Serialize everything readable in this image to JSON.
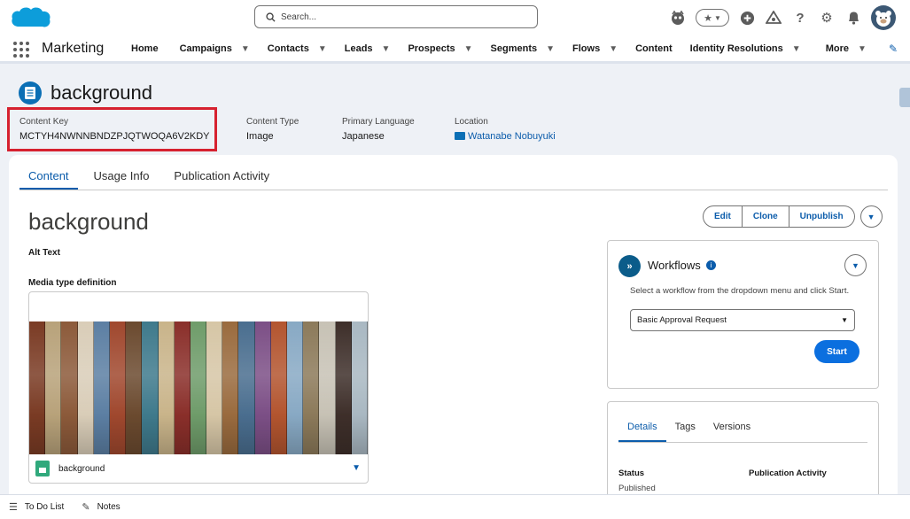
{
  "header": {
    "search_placeholder": "Search...",
    "icons": [
      "salesforce-logo-icon",
      "search-icon",
      "guide-icon",
      "favorite-star-icon",
      "favorites-list-icon",
      "global-create-icon",
      "trailhead-icon",
      "help-icon",
      "setup-gear-icon",
      "notification-bell-icon",
      "user-avatar-icon"
    ]
  },
  "nav": {
    "app_name": "Marketing",
    "items": [
      {
        "label": "Home",
        "dropdown": false
      },
      {
        "label": "Campaigns",
        "dropdown": true
      },
      {
        "label": "Contacts",
        "dropdown": true
      },
      {
        "label": "Leads",
        "dropdown": true
      },
      {
        "label": "Prospects",
        "dropdown": true
      },
      {
        "label": "Segments",
        "dropdown": true
      },
      {
        "label": "Flows",
        "dropdown": true
      },
      {
        "label": "Content",
        "dropdown": false
      },
      {
        "label": "Identity Resolutions",
        "dropdown": true
      }
    ],
    "more_label": "More"
  },
  "record": {
    "title": "background",
    "fields": [
      {
        "label": "Content Key",
        "value": "MCTYH4NWNNBNDZPJQTWOQA6V2KDY"
      },
      {
        "label": "Content Type",
        "value": "Image"
      },
      {
        "label": "Primary Language",
        "value": "Japanese"
      },
      {
        "label": "Location",
        "value": "Watanabe Nobuyuki"
      }
    ]
  },
  "tabs": [
    "Content",
    "Usage Info",
    "Publication Activity"
  ],
  "content": {
    "title": "background",
    "buttons": [
      "Edit",
      "Clone",
      "Unpublish"
    ],
    "alt_text_label": "Alt Text",
    "media_type_label": "Media type definition",
    "image_file_name": "background",
    "plank_colors": [
      "#7a3b24",
      "#b8a27a",
      "#8c5a3a",
      "#d9cdb8",
      "#5c7fa3",
      "#a0482e",
      "#6b4a2f",
      "#3f7a8c",
      "#c9b48a",
      "#8a2f2a",
      "#6f9c6a",
      "#d6c6a6",
      "#9a6b3e",
      "#4a6e8f",
      "#7c4f86",
      "#b3552f",
      "#88a9c4",
      "#8c7a5a",
      "#c7c2b5",
      "#3e2f2a",
      "#a9b8c2"
    ]
  },
  "workflows": {
    "title": "Workflows",
    "description": "Select a workflow from the dropdown menu and click Start.",
    "selected": "Basic Approval Request",
    "start_label": "Start"
  },
  "details": {
    "tabs": [
      "Details",
      "Tags",
      "Versions"
    ],
    "status_label": "Status",
    "status_value": "Published",
    "publication_label": "Publication Activity"
  },
  "utility": {
    "items": [
      "To Do List",
      "Notes"
    ]
  }
}
